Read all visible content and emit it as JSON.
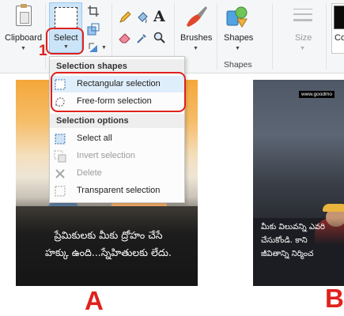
{
  "ribbon": {
    "clipboard_label": "Clipboard",
    "select_label": "Select",
    "brushes_label": "Brushes",
    "shapes_label": "Shapes",
    "shapes_group_title": "Shapes",
    "size_label": "Size",
    "colors_label": "Co"
  },
  "annotations": {
    "step_number": "1",
    "image_a_label": "A",
    "image_b_label": "B",
    "accent_color": "#e0211d"
  },
  "select_menu": {
    "section1_title": "Selection shapes",
    "section2_title": "Selection options",
    "items": [
      {
        "label": "Rectangular selection",
        "icon": "rectangle-selection-icon",
        "enabled": true
      },
      {
        "label": "Free-form selection",
        "icon": "freeform-selection-icon",
        "enabled": true
      },
      {
        "label": "Select all",
        "icon": "select-all-icon",
        "enabled": true
      },
      {
        "label": "Invert selection",
        "icon": "invert-selection-icon",
        "enabled": false
      },
      {
        "label": "Delete",
        "icon": "delete-icon",
        "enabled": false
      },
      {
        "label": "Transparent selection",
        "icon": "transparent-selection-icon",
        "enabled": true
      }
    ]
  },
  "canvas": {
    "image_a": {
      "quote_line1": "ప్రేమికులకు మీకు ద్రోహం చేసే",
      "quote_line2": "హక్కు ఉంది...స్నేహితులకు లేదు."
    },
    "image_b": {
      "watermark": "www.goodmo",
      "quote_line1": "మీకు విలువన్ని ఎవరి",
      "quote_line2": "చేసుకోండి. కాని",
      "quote_line3": "జీవితాన్ని నిర్మించ"
    }
  }
}
